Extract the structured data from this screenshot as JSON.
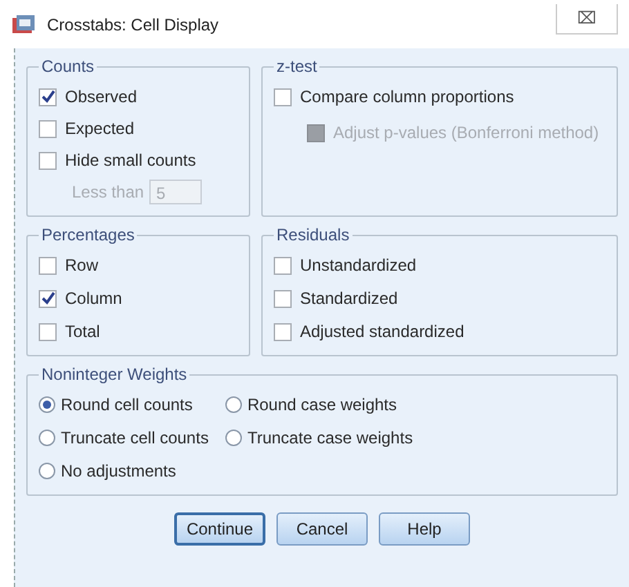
{
  "window": {
    "title": "Crosstabs: Cell Display",
    "close": "⌧"
  },
  "counts": {
    "title": "Counts",
    "items": [
      {
        "label": "Observed",
        "checked": true,
        "disabled": false
      },
      {
        "label": "Expected",
        "checked": false,
        "disabled": false
      },
      {
        "label": "Hide small counts",
        "checked": false,
        "disabled": false
      }
    ],
    "less_than": {
      "label": "Less than",
      "value": "5",
      "disabled": true
    }
  },
  "z_test": {
    "title": "z-test",
    "items": [
      {
        "label": "Compare column proportions",
        "checked": false,
        "disabled": false,
        "indent": false
      },
      {
        "label": "Adjust p-values (Bonferroni method)",
        "checked": false,
        "disabled": true,
        "indent": true
      }
    ]
  },
  "percentages": {
    "title": "Percentages",
    "items": [
      {
        "label": "Row",
        "checked": false,
        "disabled": false
      },
      {
        "label": "Column",
        "checked": true,
        "disabled": false
      },
      {
        "label": "Total",
        "checked": false,
        "disabled": false
      }
    ]
  },
  "residuals": {
    "title": "Residuals",
    "items": [
      {
        "label": "Unstandardized",
        "checked": false,
        "disabled": false
      },
      {
        "label": "Standardized",
        "checked": false,
        "disabled": false
      },
      {
        "label": "Adjusted standardized",
        "checked": false,
        "disabled": false
      }
    ]
  },
  "noninteger_weights": {
    "title": "Noninteger Weights",
    "options": [
      {
        "label": "Round cell counts",
        "selected": true
      },
      {
        "label": "Round case weights",
        "selected": false
      },
      {
        "label": "Truncate cell counts",
        "selected": false
      },
      {
        "label": "Truncate case weights",
        "selected": false
      },
      {
        "label": "No adjustments",
        "selected": false
      }
    ]
  },
  "buttons": [
    {
      "label": "Continue",
      "default": true
    },
    {
      "label": "Cancel",
      "default": false
    },
    {
      "label": "Help",
      "default": false
    }
  ]
}
